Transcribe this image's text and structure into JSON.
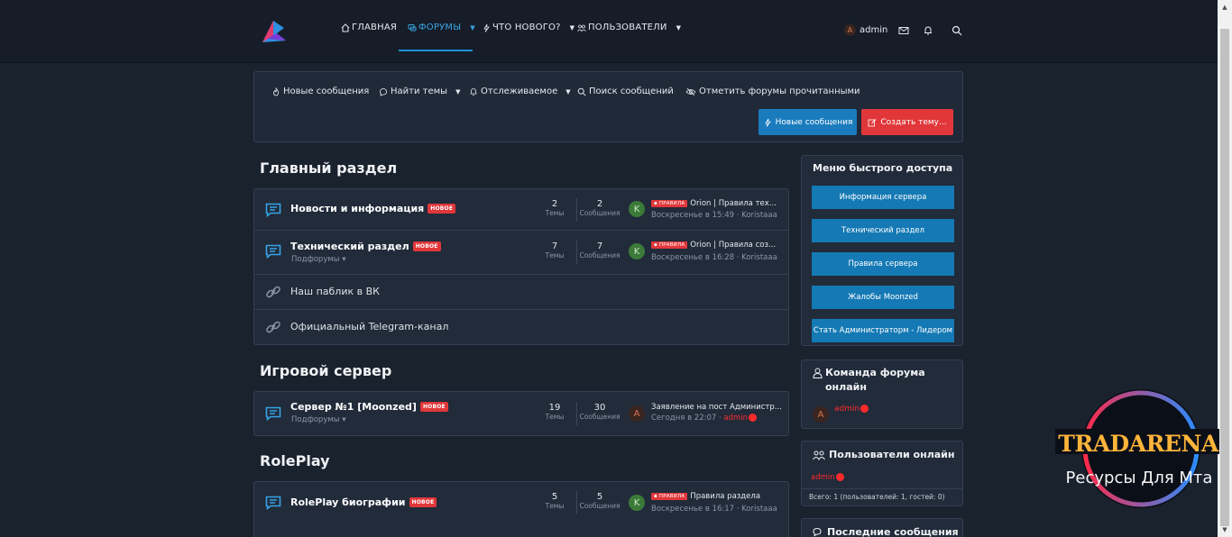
{
  "nav": {
    "home": "ГЛАВНАЯ",
    "forums": "ФОРУМЫ",
    "whats_new": "ЧТО НОВОГО?",
    "members": "ПОЛЬЗОВАТЕЛИ",
    "user": "admin",
    "user_initial": "A"
  },
  "actions": {
    "new_posts": "Новые сообщения",
    "find_threads": "Найти темы",
    "watched": "Отслеживаемое",
    "search_posts": "Поиск сообщений",
    "mark_read": "Отметить форумы прочитанными",
    "btn_new_posts": "Новые сообщения",
    "btn_create": "Создать тему..."
  },
  "labels": {
    "threads": "Темы",
    "messages": "Сообщения",
    "subforums": "Подфорумы",
    "new_badge": "НОВОЕ",
    "prefix": "ПРАВИЛА"
  },
  "sections": [
    {
      "title": "Главный раздел",
      "forums": [
        {
          "title": "Новости и информация",
          "threads": "2",
          "messages": "2",
          "last_title": "Orion | Правила тех...",
          "last_meta": "Воскресенье в 15:49 · Koristaaa",
          "avatar": "K"
        },
        {
          "title": "Технический раздел",
          "threads": "7",
          "messages": "7",
          "last_title": "Orion | Правила соз...",
          "last_meta": "Воскресенье в 16:28 · Koristaaa",
          "avatar": "K"
        },
        {
          "title": "Наш паблик в ВК"
        },
        {
          "title": "Официальный Telegram-канал"
        }
      ]
    },
    {
      "title": "Игровой сервер",
      "forums": [
        {
          "title": "Сервер №1 [Moonzed]",
          "threads": "19",
          "messages": "30",
          "last_title": "Заявление на пост Администр...",
          "last_meta_pre": "Сегодня в 22:07 · ",
          "last_user": "admin",
          "avatar": "A"
        }
      ]
    },
    {
      "title": "RolePlay",
      "forums": [
        {
          "title": "RolePlay биографии",
          "threads": "5",
          "messages": "5",
          "last_title": "Правила раздела",
          "last_meta": "Воскресенье в 16:17 · Koristaaa",
          "avatar": "K"
        }
      ]
    }
  ],
  "sidebar": {
    "quick_title": "Меню быстрого доступа",
    "quick_links": [
      "Информация сервера",
      "Технический раздел",
      "Правила сервера",
      "Жалобы Moonzed",
      "Стать Администраторм - Лидером"
    ],
    "staff_title": "Команда форума онлайн",
    "staff_user": "admin",
    "online_title": "Пользователи онлайн",
    "online_user": "admin",
    "online_total": "Всего: 1 (пользователей: 1, гостей: 0)",
    "latest_title": "Последние сообщения"
  },
  "watermark": {
    "brand": "TRADARENA",
    "tagline": "Ресурсы Для Мта"
  },
  "colors": {
    "accent": "#1e90d8",
    "danger": "#e1373a",
    "background": "#1a222e",
    "panel": "#212b3a"
  }
}
